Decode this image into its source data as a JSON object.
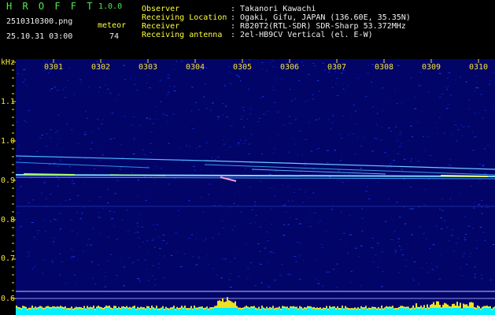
{
  "app": {
    "name": "H R O F F T",
    "version": "1.0.0"
  },
  "file": {
    "name": "2510310300.png",
    "datetime": "25.10.31 03:00"
  },
  "meteor": {
    "label": "meteor",
    "count": "74"
  },
  "info": [
    {
      "key": "Observer",
      "value": ": Takanori Kawachi"
    },
    {
      "key": "Receiving Location",
      "value": ": Ogaki, Gifu, JAPAN (136.60E, 35.35N)"
    },
    {
      "key": "Receiver",
      "value": ": R820T2(RTL-SDR) SDR-Sharp 53.372MHz"
    },
    {
      "key": "Receiving antenna",
      "value": ": 2el-HB9CV Vertical (el. E-W)"
    }
  ],
  "axis": {
    "unit": "kHz",
    "y_ticks": [
      "1.1",
      "1.0",
      "0.9",
      "0.8",
      "0.7",
      "0.6"
    ],
    "x_ticks": [
      "0301",
      "0302",
      "0303",
      "0304",
      "0305",
      "0306",
      "0307",
      "0308",
      "0309",
      "0310"
    ]
  },
  "colors": {
    "background": "#000000",
    "spectrum": "#020468",
    "label": "#f2e23a",
    "header_green": "#54e854",
    "header_white": "#f2f2f2",
    "level_bar": "#00ffff"
  }
}
